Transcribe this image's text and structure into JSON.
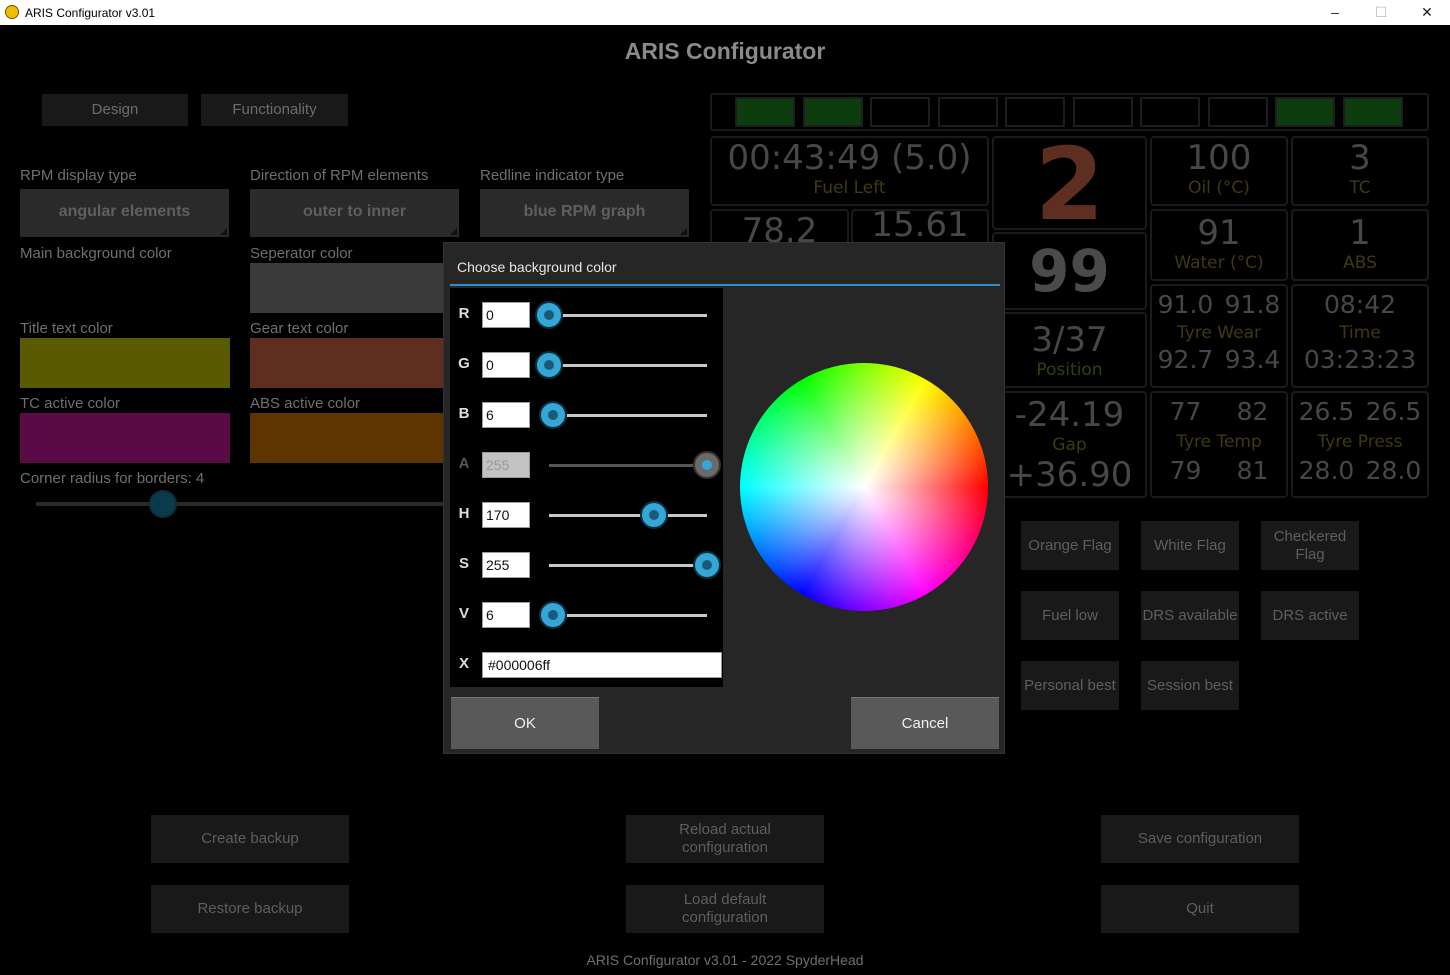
{
  "window": {
    "title": "ARIS Configurator v3.01",
    "minimize": "–",
    "maximize": "☐",
    "close": "✕"
  },
  "app_title": "ARIS Configurator",
  "tabs": [
    "Design",
    "Functionality"
  ],
  "settings": {
    "rpm_display_type": {
      "label": "RPM display type",
      "value": "angular elements"
    },
    "rpm_direction": {
      "label": "Direction of RPM elements",
      "value": "outer to inner"
    },
    "redline_type": {
      "label": "Redline indicator type",
      "value": "blue RPM graph"
    },
    "main_bg": {
      "label": "Main background color",
      "color": "#000000"
    },
    "separator": {
      "label": "Seperator color",
      "color": "#3a3a3a"
    },
    "title_text": {
      "label": "Title text color",
      "color": "#5a5a00"
    },
    "gear_text": {
      "label": "Gear text color",
      "color": "#5e2f20"
    },
    "tc_active": {
      "label": "TC active color",
      "color": "#5a0a45"
    },
    "abs_active": {
      "label": "ABS active color",
      "color": "#5e3400"
    },
    "corner_radius": {
      "label": "Corner radius for borders: 4",
      "value": 4,
      "max": 20
    }
  },
  "preview": {
    "leds": [
      "#0d3d0d",
      "#0d3d0d",
      "#000000",
      "#000000",
      "#000000",
      "#000000",
      "#000000",
      "#000000",
      "#0d3d0d",
      "#0d3d0d"
    ],
    "fuel_time": "00:43:49 (5.0)",
    "fuel_label": "Fuel Left",
    "val_a": "78.2",
    "val_b": "15.61",
    "gear": "2",
    "speed": "99",
    "position": "3/37",
    "position_label": "Position",
    "gap1": "-24.19",
    "gap_label": "Gap",
    "gap2": "+36.90",
    "oil": "100",
    "oil_label": "Oil (°C)",
    "tc": "3",
    "tc_label": "TC",
    "water": "91",
    "water_label": "Water (°C)",
    "abs": "1",
    "abs_label": "ABS",
    "wear_fl": "91.0",
    "wear_fr": "91.8",
    "wear_label": "Tyre Wear",
    "wear_rl": "92.7",
    "wear_rr": "93.4",
    "time_top": "08:42",
    "time_label": "Time",
    "time_bottom": "03:23:23",
    "temp_fl": "77",
    "temp_fr": "82",
    "temp_label": "Tyre Temp",
    "temp_rl": "79",
    "temp_rr": "81",
    "press_fl": "26.5",
    "press_fr": "26.5",
    "press_label": "Tyre Press",
    "press_rl": "28.0",
    "press_rr": "28.0"
  },
  "flag_buttons": {
    "orange_flag": "Orange Flag",
    "white_flag": "White Flag",
    "checkered_flag": "Checkered Flag",
    "fuel_low": "Fuel low",
    "drs_available": "DRS available",
    "drs_active": "DRS active",
    "personal_best": "Personal best",
    "session_best": "Session best"
  },
  "actions": {
    "create_backup": "Create backup",
    "restore_backup": "Restore backup",
    "reload": "Reload actual configuration",
    "load_default": "Load default configuration",
    "save": "Save configuration",
    "quit": "Quit"
  },
  "footer": "ARIS Configurator v3.01 - 2022 SpyderHead",
  "dialog": {
    "title": "Choose background color",
    "channels": [
      {
        "label": "R",
        "value": "0",
        "fraction": 0.0,
        "enabled": true
      },
      {
        "label": "G",
        "value": "0",
        "fraction": 0.0,
        "enabled": true
      },
      {
        "label": "B",
        "value": "6",
        "fraction": 0.0235,
        "enabled": true
      },
      {
        "label": "A",
        "value": "255",
        "fraction": 1.0,
        "enabled": false
      },
      {
        "label": "H",
        "value": "170",
        "fraction": 0.6667,
        "enabled": true
      },
      {
        "label": "S",
        "value": "255",
        "fraction": 1.0,
        "enabled": true
      },
      {
        "label": "V",
        "value": "6",
        "fraction": 0.0235,
        "enabled": true
      }
    ],
    "hex_label": "X",
    "hex_value": "#000006ff",
    "ok": "OK",
    "cancel": "Cancel"
  }
}
